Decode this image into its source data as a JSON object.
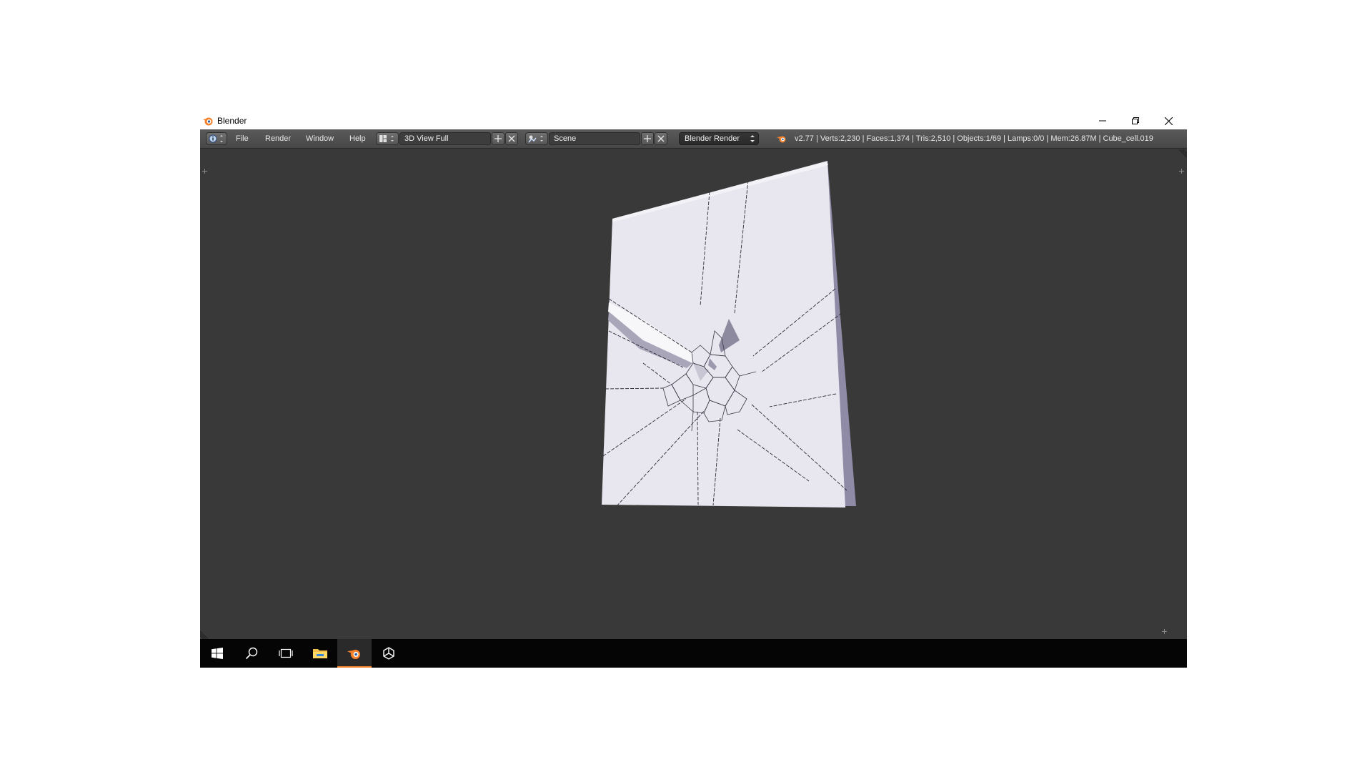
{
  "window": {
    "title": "Blender"
  },
  "header": {
    "menus": [
      "File",
      "Render",
      "Window",
      "Help"
    ],
    "screen_layout": "3D View Full",
    "scene": "Scene",
    "render_engine": "Blender Render",
    "stats": "v2.77 | Verts:2,230 | Faces:1,374 | Tris:2,510 | Objects:1/69 | Lamps:0/0 | Mem:26.87M | Cube_cell.019"
  },
  "taskbar": {
    "items": [
      "windows-start-icon",
      "search-icon",
      "task-view-icon",
      "file-explorer-icon",
      "blender-icon",
      "unity-icon"
    ],
    "active": "blender-icon"
  },
  "colors": {
    "viewport_bg": "#393939",
    "mesh_face": "#e8e6ee",
    "accent": "#f5822a"
  }
}
